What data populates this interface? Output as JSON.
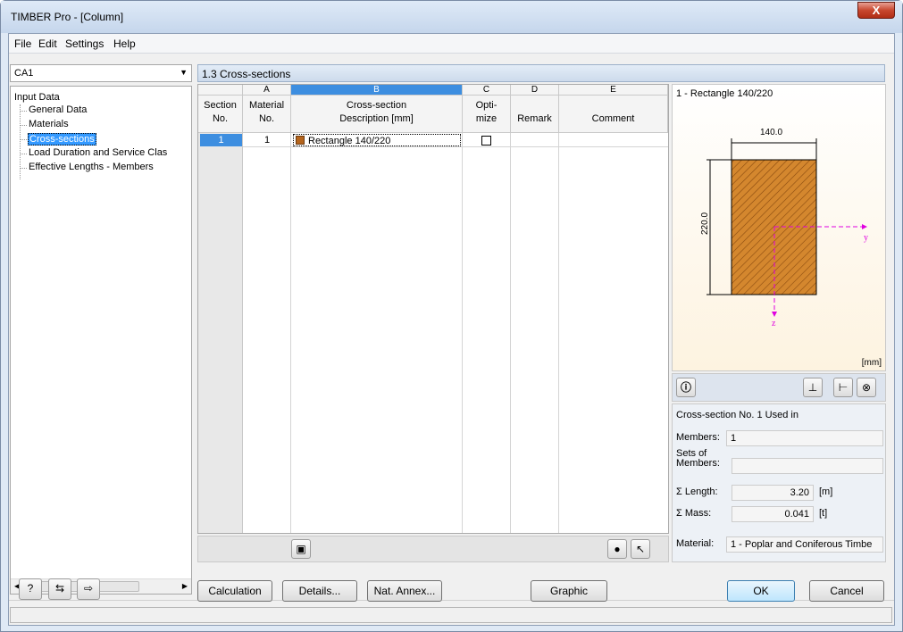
{
  "window": {
    "title": "TIMBER Pro - [Column]",
    "close_glyph": "X"
  },
  "menu": [
    "File",
    "Edit",
    "Settings",
    "Help"
  ],
  "case_select": {
    "value": "CA1"
  },
  "nav": {
    "root": "Input Data",
    "items": [
      "General Data",
      "Materials",
      "Cross-sections",
      "Load Duration and Service Clas",
      "Effective Lengths - Members"
    ],
    "selected_index": 2,
    "scroll_glyph": "III"
  },
  "section_title": "1.3 Cross-sections",
  "grid": {
    "row_header": "Section No.",
    "row_header_l1": "Section",
    "row_header_l2": "No.",
    "columns": [
      {
        "letter": "A",
        "l1": "Material",
        "l2": "No."
      },
      {
        "letter": "B",
        "l1": "Cross-section",
        "l2": "Description [mm]"
      },
      {
        "letter": "C",
        "l1": "Opti-",
        "l2": "mize"
      },
      {
        "letter": "D",
        "l1": "",
        "l2": "Remark"
      },
      {
        "letter": "E",
        "l1": "",
        "l2": "Comment"
      }
    ],
    "rows": [
      {
        "no": "1",
        "material": "1",
        "description": "Rectangle 140/220",
        "optimize": false,
        "remark": "",
        "comment": ""
      }
    ]
  },
  "preview": {
    "title": "1 - Rectangle 140/220",
    "width_label": "140.0",
    "height_label": "220.0",
    "axis_y": "y",
    "axis_z": "z",
    "unit": "[mm]",
    "fill_color": "#d4872e"
  },
  "info": {
    "heading": "Cross-section No. 1 Used in",
    "members_label": "Members:",
    "members_value": "1",
    "sets_label_1": "Sets of",
    "sets_label_2": "Members:",
    "sets_value": "",
    "length_label": "Σ Length:",
    "length_value": "3.20",
    "length_unit": "[m]",
    "mass_label": "Σ Mass:",
    "mass_value": "0.041",
    "mass_unit": "[t]",
    "material_label": "Material:",
    "material_value": "1 - Poplar and Coniferous Timbe"
  },
  "buttons": {
    "calculation": "Calculation",
    "details": "Details...",
    "nat_annex": "Nat. Annex...",
    "graphic": "Graphic",
    "ok": "OK",
    "cancel": "Cancel"
  }
}
